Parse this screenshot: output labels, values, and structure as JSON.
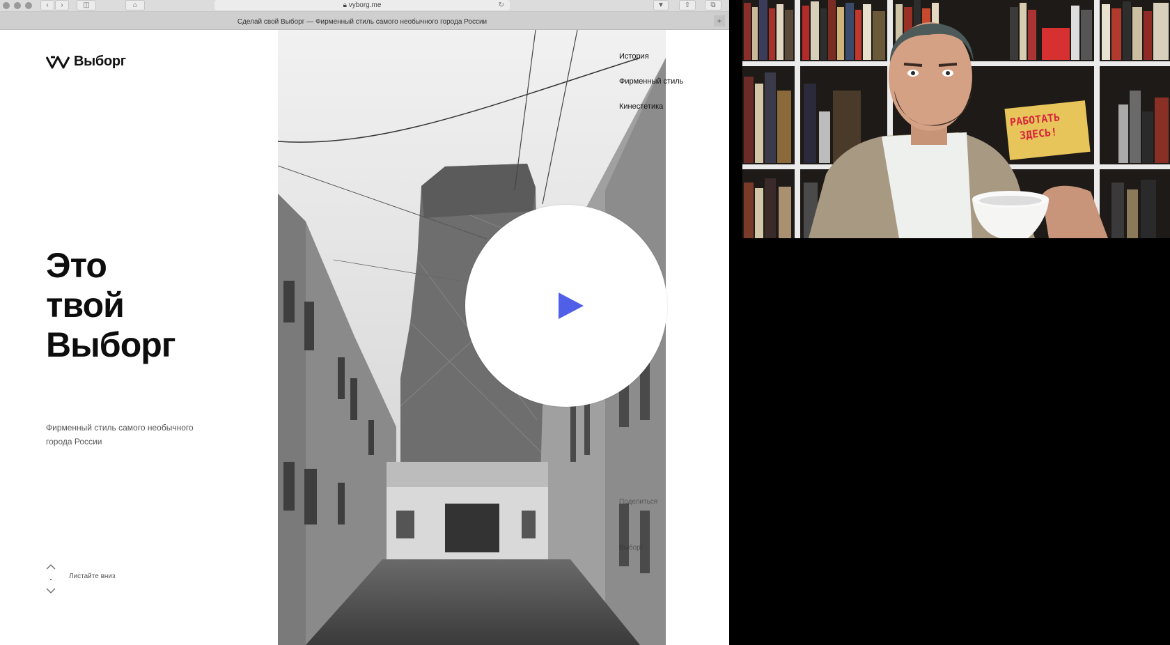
{
  "browser": {
    "url": "vyborg.me",
    "tab_title": "Сделай свой Выборг — Фирменный стиль самого необычного города России",
    "new_tab": "+"
  },
  "site": {
    "logo_text": "Выборг",
    "nav": [
      "История",
      "Фирменный стиль",
      "Кинестетика"
    ],
    "hero_lines": [
      "Это",
      "твой",
      "Выборг"
    ],
    "subtitle": "Фирменный стиль самого необычного города России",
    "scroll_hint": "Листайте вниз",
    "side_links": [
      "Поделиться",
      "Выборг"
    ]
  },
  "video": {
    "accent_color": "#4f5fe8",
    "play_icon": "play-icon"
  },
  "webcam": {
    "poster_line1": "РАБОТАТЬ",
    "poster_line2": "ЗДЕСЬ!"
  }
}
